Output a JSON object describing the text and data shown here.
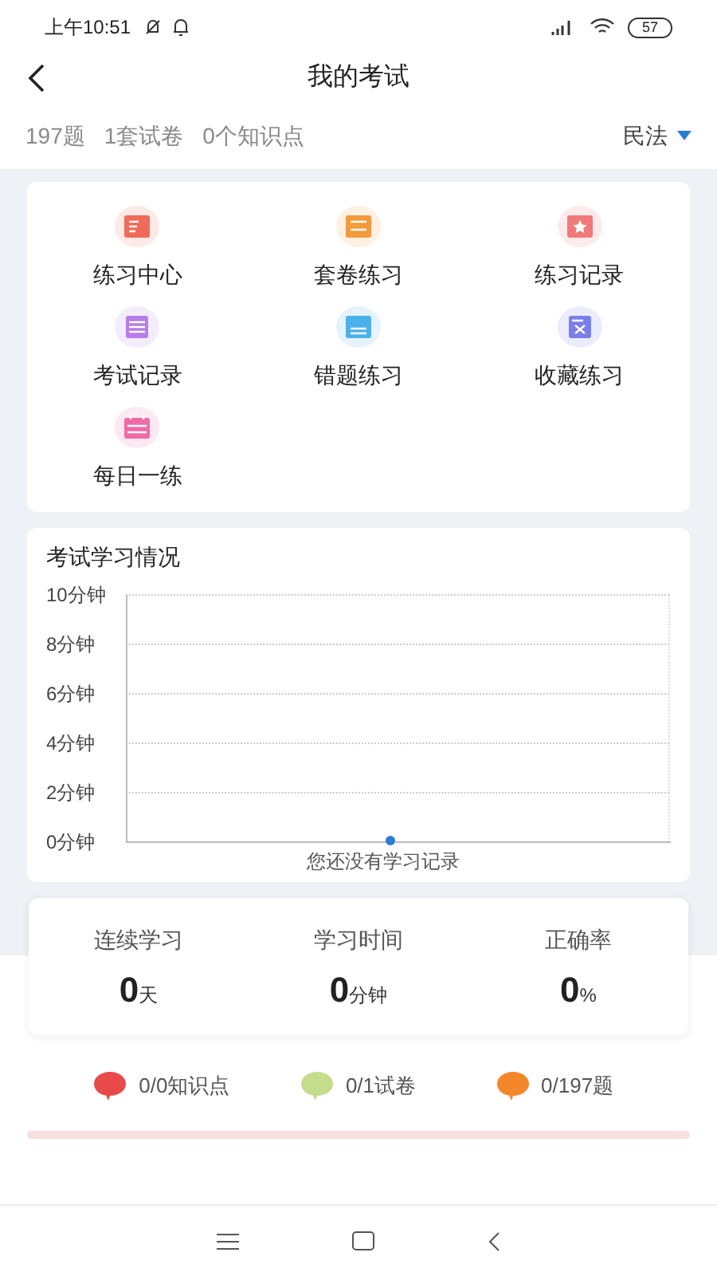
{
  "status_bar": {
    "time": "上午10:51",
    "battery": "57"
  },
  "header": {
    "title": "我的考试"
  },
  "summary": {
    "items": [
      "197题",
      "1套试卷",
      "0个知识点"
    ],
    "subject": "民法"
  },
  "menu": [
    {
      "label": "练习中心",
      "color": "#f06a5a",
      "kind": "edit"
    },
    {
      "label": "套卷练习",
      "color": "#f59a3c",
      "kind": "paper"
    },
    {
      "label": "练习记录",
      "color": "#f07a7a",
      "kind": "star"
    },
    {
      "label": "考试记录",
      "color": "#b77de8",
      "kind": "list"
    },
    {
      "label": "错题练习",
      "color": "#4cb0ea",
      "kind": "score"
    },
    {
      "label": "收藏练习",
      "color": "#7b7fe8",
      "kind": "cross"
    },
    {
      "label": "每日一练",
      "color": "#f06aa8",
      "kind": "calendar"
    }
  ],
  "study_chart": {
    "title": "考试学习情况",
    "empty_message": "您还没有学习记录",
    "chart_data": {
      "type": "line",
      "ylim": [
        0,
        10
      ],
      "yticks": [
        {
          "value": 0,
          "label": "0分钟"
        },
        {
          "value": 2,
          "label": "2分钟"
        },
        {
          "value": 4,
          "label": "4分钟"
        },
        {
          "value": 6,
          "label": "6分钟"
        },
        {
          "value": 8,
          "label": "8分钟"
        },
        {
          "value": 10,
          "label": "10分钟"
        }
      ],
      "grid": true,
      "series": [
        {
          "color": "#2b7cd3",
          "marker": true,
          "values": [
            0
          ]
        }
      ]
    }
  },
  "stats": [
    {
      "label": "连续学习",
      "value": "0",
      "unit": "天"
    },
    {
      "label": "学习时间",
      "value": "0",
      "unit": "分钟"
    },
    {
      "label": "正确率",
      "value": "0",
      "unit": "%"
    }
  ],
  "legend": [
    {
      "text": "0/0知识点",
      "color": "#e84a4a"
    },
    {
      "text": "0/1试卷",
      "color": "#c5dc8c"
    },
    {
      "text": "0/197题",
      "color": "#f5862a"
    }
  ]
}
